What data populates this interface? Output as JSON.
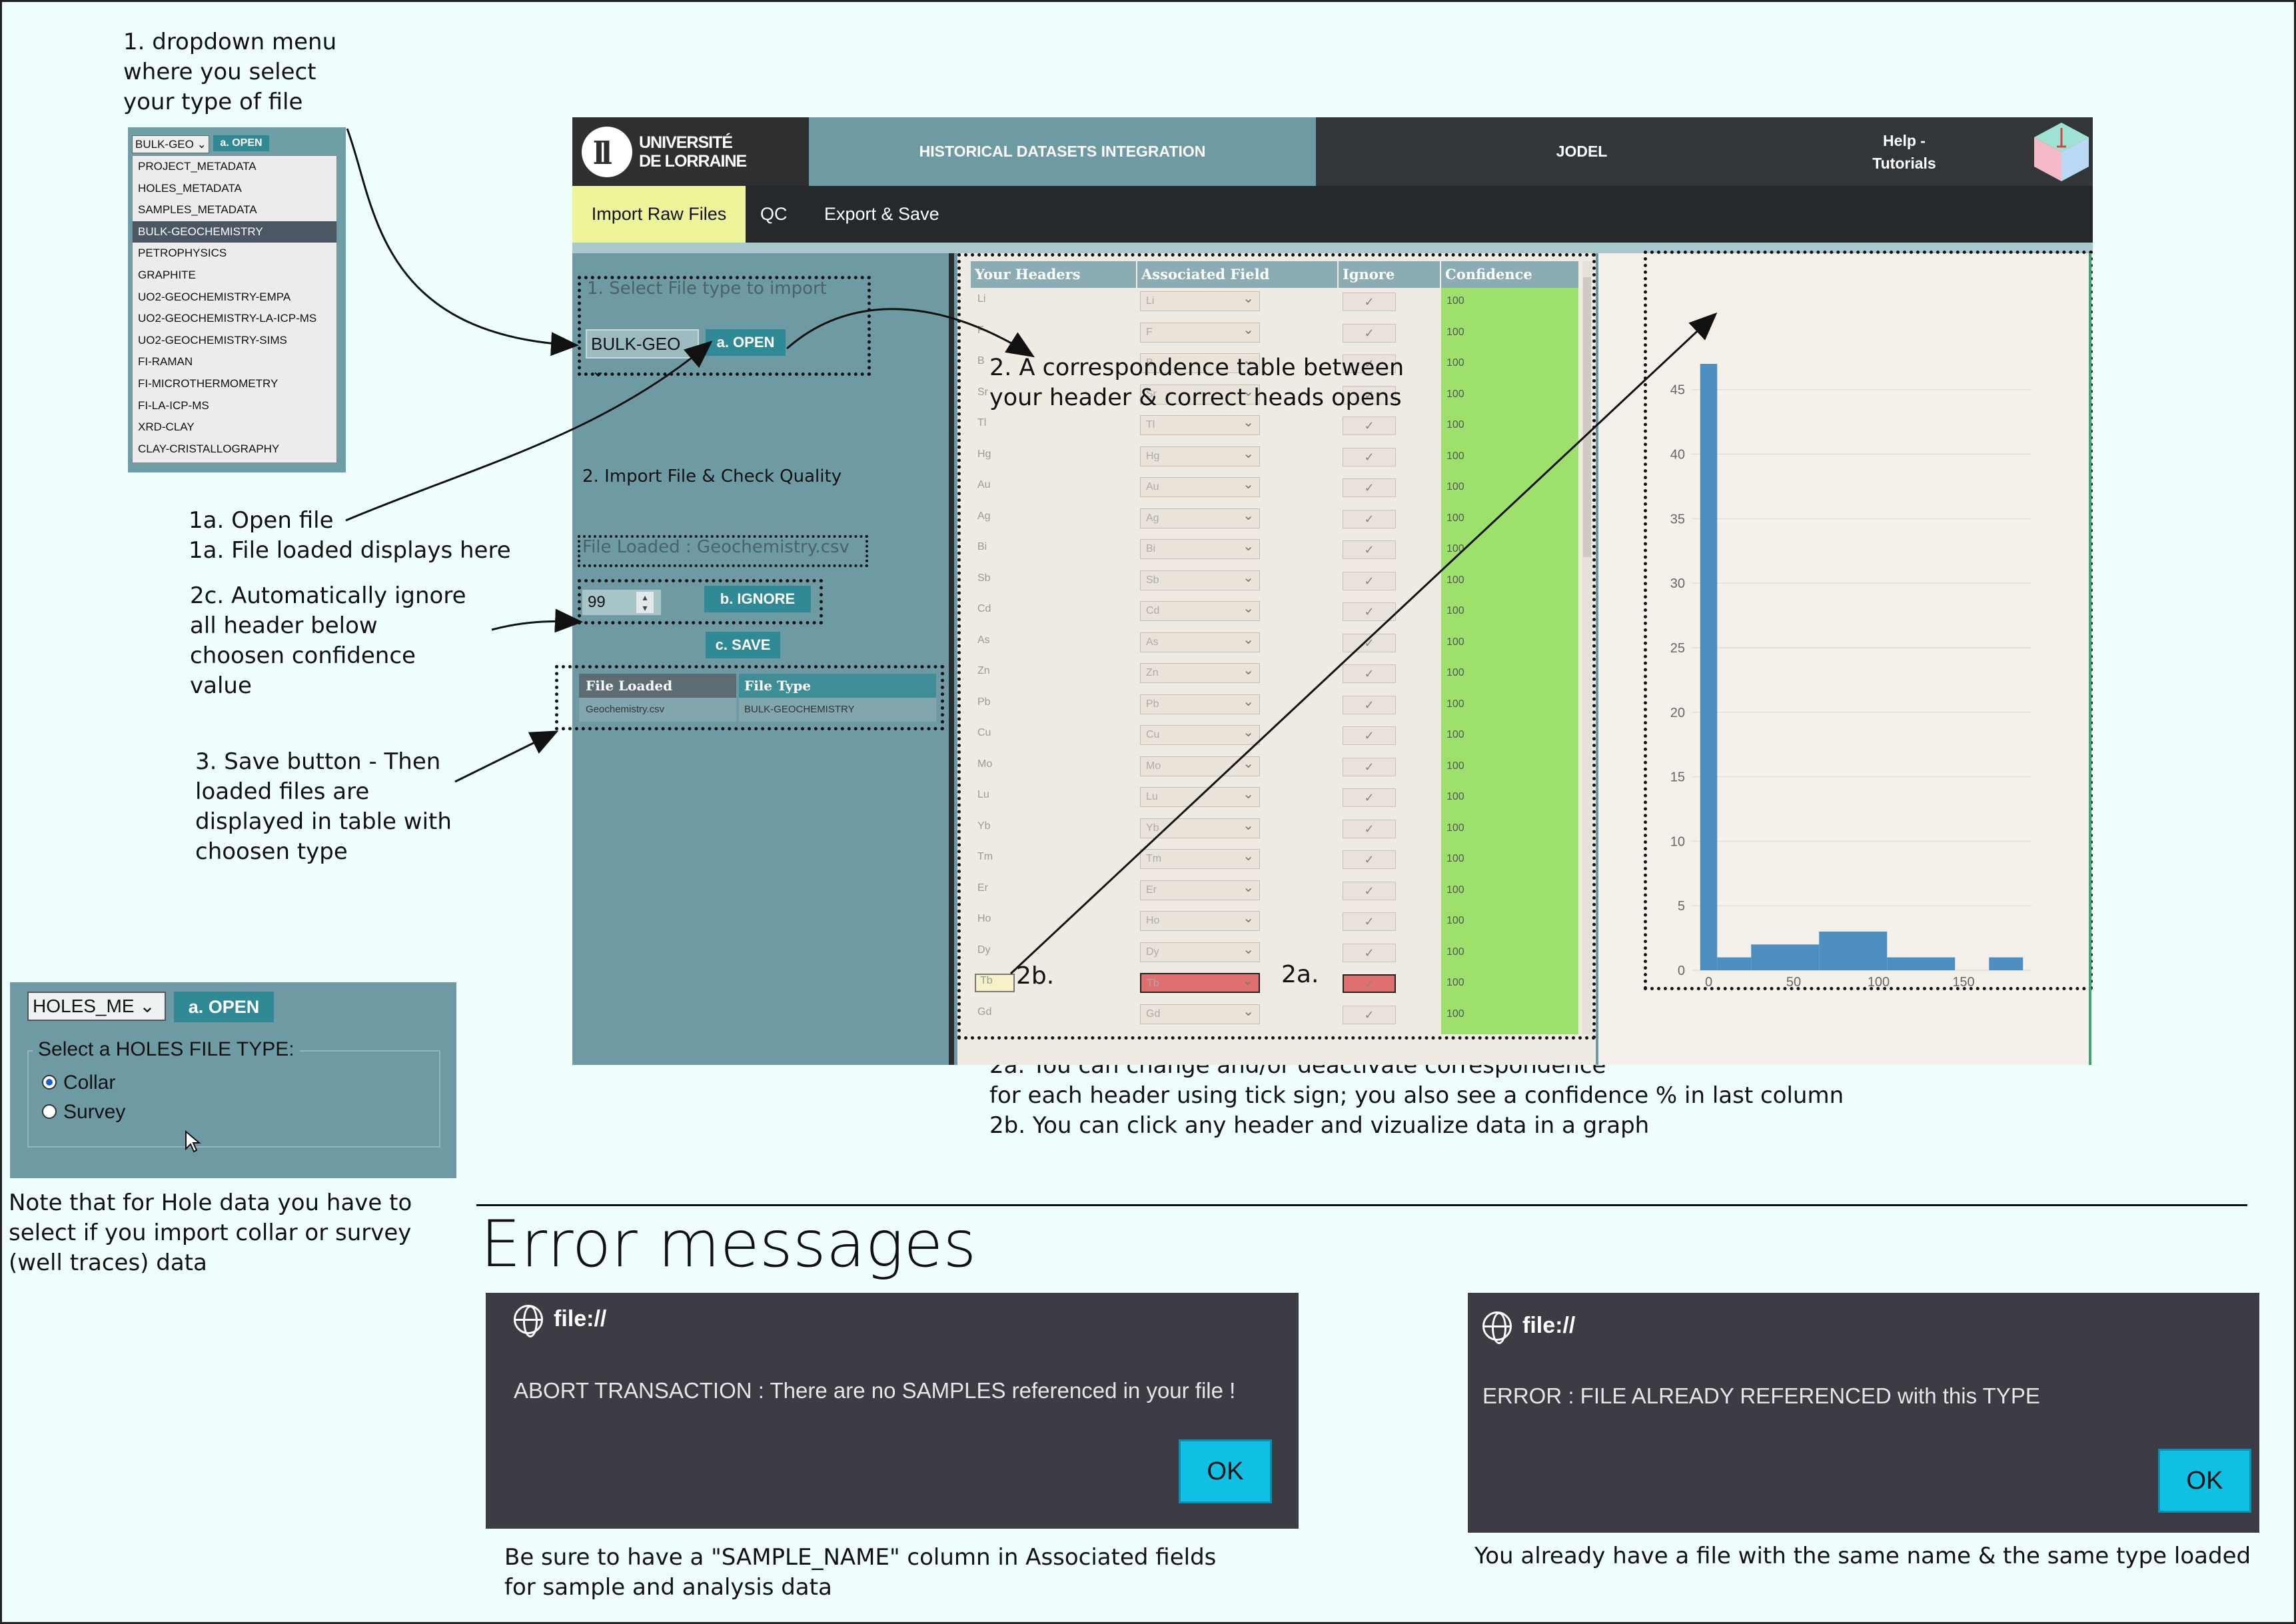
{
  "annotations": {
    "dropdown_note": "1. dropdown menu\nwhere you select\nyour type of file",
    "open_file": "1a. Open file\n1a. File loaded displays here",
    "auto_ignore": "2c. Automatically ignore\nall header below\nchoosen confidence\nvalue",
    "save_note": "3. Save button - Then\nloaded files are\ndisplayed in table with\nchoosen type",
    "holes_note": "Note that for Hole data you have to\nselect if you import collar or survey\n(well traces) data",
    "corr_note": "2. A correspondence table between\nyour header & correct heads opens",
    "corr_explain": "2a. You can change and/or deactivate correspondence\nfor each header using tick sign; you also see a confidence % in last column\n2b. You can click any header and vizualize data in a graph",
    "mark_2b": "2b.",
    "mark_2a": "2a."
  },
  "dropdown_sample": {
    "selected": "BULK-GEO",
    "open_label": "a. OPEN",
    "options": [
      "PROJECT_METADATA",
      "HOLES_METADATA",
      "SAMPLES_METADATA",
      "BULK-GEOCHEMISTRY",
      "PETROPHYSICS",
      "GRAPHITE",
      "UO2-GEOCHEMISTRY-EMPA",
      "UO2-GEOCHEMISTRY-LA-ICP-MS",
      "UO2-GEOCHEMISTRY-SIMS",
      "FI-RAMAN",
      "FI-MICROTHERMOMETRY",
      "FI-LA-ICP-MS",
      "XRD-CLAY",
      "CLAY-CRISTALLOGRAPHY"
    ],
    "selected_option": "BULK-GEOCHEMISTRY"
  },
  "app": {
    "logo_line1": "UNIVERSITÉ",
    "logo_line2": "DE LORRAINE",
    "nav_hist": "HISTORICAL DATASETS INTEGRATION",
    "nav_jodel": "JODEL",
    "nav_help": "Help -\nTutorials",
    "sub_import": "Import Raw Files",
    "sub_qc": "QC",
    "sub_export": "Export & Save",
    "select_label": "1. Select File type to import",
    "file_type_value": "BULK-GEO",
    "open_label": "a. OPEN",
    "import_label": "2. Import File & Check Quality",
    "file_loaded": "File Loaded : Geochemistry.csv",
    "confidence_value": "99",
    "ignore_label": "b. IGNORE",
    "save_label": "c. SAVE",
    "loaded_table": {
      "headers": [
        "File Loaded",
        "File Type"
      ],
      "row": [
        "Geochemistry.csv",
        "BULK-GEOCHEMISTRY"
      ]
    }
  },
  "correspondence": {
    "headers": [
      "Your Headers",
      "Associated Field",
      "Ignore",
      "Confidence"
    ],
    "rows": [
      {
        "h": "Li",
        "f": "Li",
        "c": "100"
      },
      {
        "h": "F",
        "f": "F",
        "c": "100"
      },
      {
        "h": "B",
        "f": "B",
        "c": "100"
      },
      {
        "h": "Sr",
        "f": "Sr",
        "c": "100"
      },
      {
        "h": "Tl",
        "f": "Tl",
        "c": "100"
      },
      {
        "h": "Hg",
        "f": "Hg",
        "c": "100"
      },
      {
        "h": "Au",
        "f": "Au",
        "c": "100"
      },
      {
        "h": "Ag",
        "f": "Ag",
        "c": "100"
      },
      {
        "h": "Bi",
        "f": "Bi",
        "c": "100"
      },
      {
        "h": "Sb",
        "f": "Sb",
        "c": "100"
      },
      {
        "h": "Cd",
        "f": "Cd",
        "c": "100"
      },
      {
        "h": "As",
        "f": "As",
        "c": "100"
      },
      {
        "h": "Zn",
        "f": "Zn",
        "c": "100"
      },
      {
        "h": "Pb",
        "f": "Pb",
        "c": "100"
      },
      {
        "h": "Cu",
        "f": "Cu",
        "c": "100"
      },
      {
        "h": "Mo",
        "f": "Mo",
        "c": "100"
      },
      {
        "h": "Lu",
        "f": "Lu",
        "c": "100"
      },
      {
        "h": "Yb",
        "f": "Yb",
        "c": "100"
      },
      {
        "h": "Tm",
        "f": "Tm",
        "c": "100"
      },
      {
        "h": "Er",
        "f": "Er",
        "c": "100"
      },
      {
        "h": "Ho",
        "f": "Ho",
        "c": "100"
      },
      {
        "h": "Dy",
        "f": "Dy",
        "c": "100"
      },
      {
        "h": "Tb",
        "f": "Tb",
        "c": "100"
      },
      {
        "h": "Gd",
        "f": "Gd",
        "c": "100"
      }
    ],
    "tick": "✓",
    "highlight_color": "#e07070"
  },
  "chart_data": {
    "type": "bar",
    "title": "",
    "xlabel": "",
    "ylabel": "",
    "xlim": [
      -10,
      190
    ],
    "ylim": [
      0,
      47
    ],
    "xticks": [
      0,
      50,
      100,
      150
    ],
    "yticks": [
      0,
      5,
      10,
      15,
      20,
      25,
      30,
      35,
      40,
      45
    ],
    "bins": [
      {
        "x0": -5,
        "x1": 5,
        "value": 47
      },
      {
        "x0": 5,
        "x1": 25,
        "value": 1
      },
      {
        "x0": 25,
        "x1": 65,
        "value": 2
      },
      {
        "x0": 65,
        "x1": 105,
        "value": 3
      },
      {
        "x0": 105,
        "x1": 145,
        "value": 1
      },
      {
        "x0": 145,
        "x1": 165,
        "value": 0
      },
      {
        "x0": 165,
        "x1": 185,
        "value": 1
      }
    ],
    "color": "#4d8fc0"
  },
  "holes": {
    "selected": "HOLES_ME",
    "open_label": "a. OPEN",
    "legend": "Select a HOLES FILE TYPE:",
    "options": [
      "Collar",
      "Survey"
    ],
    "checked": "Collar"
  },
  "errors": {
    "title": "Error messages",
    "dialogs": [
      {
        "host": "file://",
        "message": "ABORT TRANSACTION : There are no SAMPLES referenced in your file !",
        "ok": "OK",
        "note": "Be sure to have a \"SAMPLE_NAME\" column in Associated fields\nfor sample and analysis data"
      },
      {
        "host": "file://",
        "message": "ERROR : FILE ALREADY REFERENCED with this TYPE",
        "ok": "OK",
        "note": "You already have a file with the same name & the same type loaded"
      }
    ]
  }
}
